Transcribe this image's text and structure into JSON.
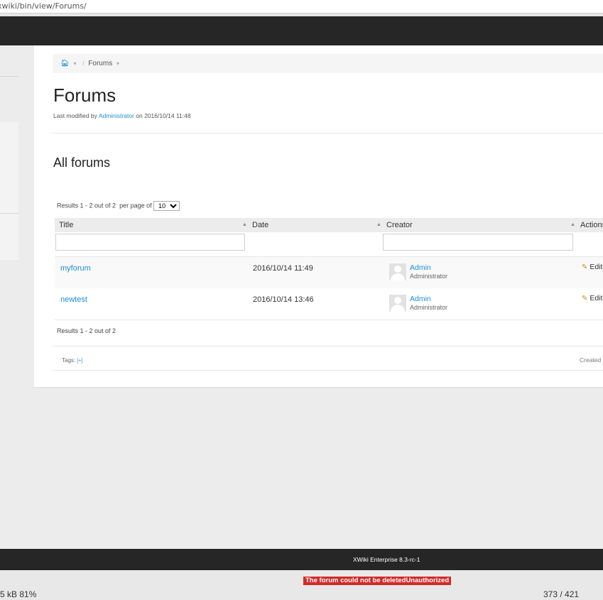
{
  "browser": {
    "url": "xwiki/bin/view/Forums/"
  },
  "breadcrumb": {
    "home_icon": "home-icon",
    "current": "Forums"
  },
  "page": {
    "title": "Forums",
    "modified_prefix": "Last modified by",
    "modified_user": "Administrator",
    "modified_suffix": "on 2016/10/14 11:48"
  },
  "section": {
    "title": "All forums"
  },
  "table": {
    "results_top": "Results 1 - 2 out of 2",
    "per_page_label": "per page of",
    "per_page_value": "10",
    "columns": {
      "title": "Title",
      "date": "Date",
      "creator": "Creator",
      "actions": "Actions"
    },
    "rows": [
      {
        "title": "myforum",
        "date": "2016/10/14 11:49",
        "creator": "Admin",
        "role": "Administrator",
        "action": "Edit"
      },
      {
        "title": "newtest",
        "date": "2016/10/14 13:46",
        "creator": "Admin",
        "role": "Administrator",
        "action": "Edit"
      }
    ],
    "results_bottom": "Results 1 - 2 out of 2"
  },
  "tags": {
    "label": "Tags:",
    "add": "[+]"
  },
  "created": {
    "label": "Created"
  },
  "footer": {
    "text": "XWiki Enterprise 8.3-rc-1"
  },
  "error": {
    "text": "The forum could not be deletedUnauthorized"
  },
  "status": {
    "size_zoom": "5 kB  81%",
    "page_count": "373 / 421"
  },
  "colors": {
    "link": "#1a8fd6",
    "topbar": "#262626",
    "error_bg": "#d22a2a"
  }
}
